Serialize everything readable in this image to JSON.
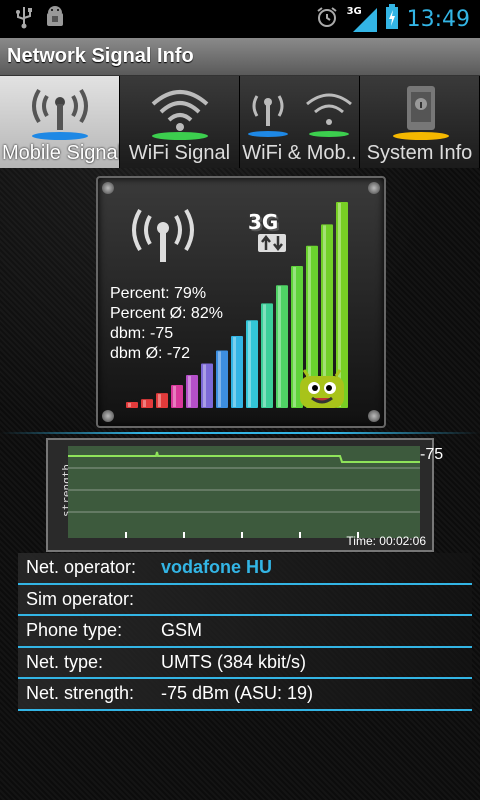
{
  "status_bar": {
    "time": "13:49",
    "network_type": "3G",
    "icons": [
      "usb-icon",
      "android-debug-icon",
      "alarm-icon",
      "signal-icon",
      "battery-charging-icon"
    ]
  },
  "app": {
    "title": "Network Signal Info"
  },
  "tabs": [
    {
      "label": "Mobile Signal",
      "icon": "cell-tower-icon",
      "active": true
    },
    {
      "label": "WiFi Signal",
      "icon": "wifi-icon",
      "active": false
    },
    {
      "label": "WiFi & Mob..",
      "icon": "wifi-mobile-icon",
      "active": false
    },
    {
      "label": "System Info",
      "icon": "phone-info-icon",
      "active": false
    }
  ],
  "meter": {
    "network_badge": "3G",
    "percent": "Percent: 79%",
    "percent_avg": "Percent Ø: 82%",
    "dbm": "dbm: -75",
    "dbm_avg": "dbm Ø: -72",
    "signal_percent": 79
  },
  "graph": {
    "y_axis_label": "strength",
    "current_value": "-75",
    "time": "Time: 00:02:06"
  },
  "info": [
    {
      "key": "Net. operator:",
      "value": "vodafone HU",
      "accent": true
    },
    {
      "key": "Sim operator:",
      "value": ""
    },
    {
      "key": "Phone type:",
      "value": "GSM"
    },
    {
      "key": "Net. type:",
      "value": "UMTS (384 kbit/s)"
    },
    {
      "key": "Net. strength:",
      "value": "-75 dBm (ASU: 19)"
    }
  ],
  "colors": {
    "accent": "#33b5e5",
    "graph_line": "#7dd35a",
    "bar_high": "#5fd33a"
  }
}
